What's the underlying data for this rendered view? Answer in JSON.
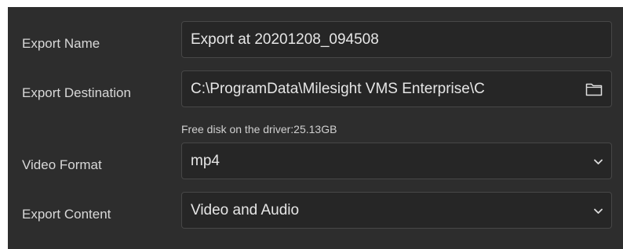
{
  "export_name": {
    "label": "Export Name",
    "value": "Export at 20201208_094508"
  },
  "export_destination": {
    "label": "Export Destination",
    "value": "C:\\ProgramData\\Milesight VMS Enterprise\\C",
    "icon": "folder-icon"
  },
  "free_disk": {
    "text": "Free disk on the driver:25.13GB"
  },
  "video_format": {
    "label": "Video Format",
    "selected": "mp4",
    "icon": "chevron-down-icon"
  },
  "export_content": {
    "label": "Export Content",
    "selected": "Video and Audio",
    "icon": "chevron-down-icon"
  },
  "colors": {
    "panel_background": "#2d2d2d",
    "field_background": "#262626",
    "field_border": "#474747",
    "text": "#e6e6e6"
  }
}
